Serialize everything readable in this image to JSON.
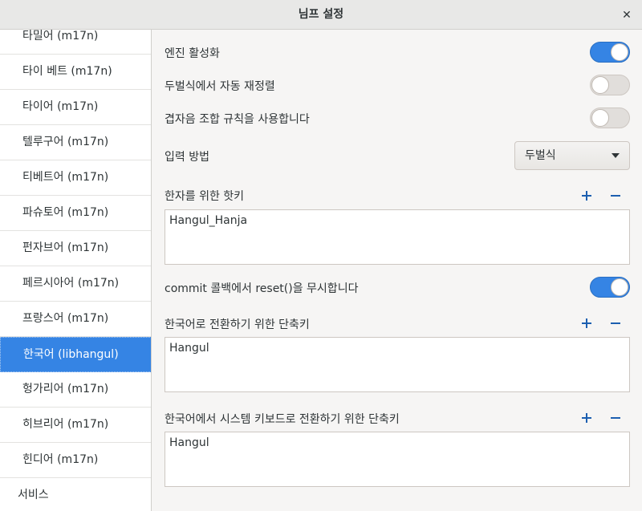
{
  "window": {
    "title": "님프 설정",
    "close_icon": "close-icon"
  },
  "sidebar": {
    "items": [
      {
        "label": "타밀어 (m17n)"
      },
      {
        "label": "타이 베트 (m17n)"
      },
      {
        "label": "타이어 (m17n)"
      },
      {
        "label": "텔루구어 (m17n)"
      },
      {
        "label": "티베트어 (m17n)"
      },
      {
        "label": "파슈토어 (m17n)"
      },
      {
        "label": "펀자브어 (m17n)"
      },
      {
        "label": "페르시아어 (m17n)"
      },
      {
        "label": "프랑스어 (m17n)"
      },
      {
        "label": "한국어 (libhangul)",
        "selected": true
      },
      {
        "label": "헝가리어 (m17n)"
      },
      {
        "label": "히브리어 (m17n)"
      },
      {
        "label": "힌디어 (m17n)"
      }
    ],
    "footer": {
      "label": "서비스"
    }
  },
  "settings": {
    "enable_engine": {
      "label": "엔진 활성화",
      "state": "on"
    },
    "dubeolsik_auto_reorder": {
      "label": "두벌식에서 자동 재정렬",
      "state": "off"
    },
    "use_compound_vowel_rule": {
      "label": "겹자음 조합 규칙을 사용합니다",
      "state": "off"
    },
    "input_method": {
      "label": "입력 방법",
      "value": "두벌식"
    },
    "hanja_hotkey": {
      "label": "한자를 위한 핫키",
      "value": "Hangul_Hanja"
    },
    "ignore_reset": {
      "label": "commit 콜백에서 reset()을 무시합니다",
      "state": "on"
    },
    "switch_to_korean": {
      "label": "한국어로 전환하기 위한 단축키",
      "value": "Hangul"
    },
    "switch_to_system": {
      "label": "한국어에서 시스템 키보드로 전환하기 위한 단축키",
      "value": "Hangul"
    }
  },
  "colors": {
    "accent": "#3584e4",
    "icon_blue": "#1c5fb0"
  }
}
